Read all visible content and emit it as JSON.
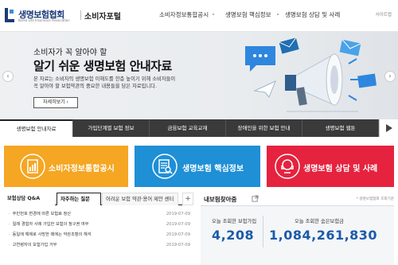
{
  "header": {
    "logo_text": "생명보험협회",
    "logo_sub": "Korea Life Insurance Association",
    "portal_title": "소비자포털",
    "nav": [
      "소비자정보통합공시",
      "생명보험 핵심정보",
      "생명보험 상담 및 사례"
    ],
    "site_map": "사이트맵"
  },
  "hero": {
    "subtitle": "소비자가 꼭 알아야 할",
    "title": "알기 쉬운 생명보험 안내자료",
    "desc_line1": "본 자료는 소비자의 생명보험 이해도를 한층 높이기 위해 소비자들이",
    "desc_line2": "꼭 알아야 할 보험약관의 중요한 내용들을 담은 자료입니다.",
    "button": "자세히보기 ›",
    "prev": "‹",
    "next": "›"
  },
  "tabs": [
    "생명보험 안내자료",
    "가입단계별 보험 정보",
    "금융보험 교육교재",
    "장애인을 위한 보험 안내",
    "생명보험 웹툰"
  ],
  "big_buttons": [
    {
      "label": "소비자정보통합공시",
      "color": "#f5a623",
      "icon": "document-chart-icon"
    },
    {
      "label": "생명보험 핵심정보",
      "color": "#1f8fd6",
      "icon": "document-search-icon"
    },
    {
      "label": "생명보험 상담 및 사례",
      "color": "#e5233f",
      "icon": "consultation-icon"
    }
  ],
  "qa": {
    "tabs": [
      "보험상담 Q&A",
      "자주하는 질문",
      "어려운 보험 약관·용어 제안 센터"
    ],
    "plus": "+",
    "rows": [
      {
        "title": "주민번호 변경에 따른 보험료 정산",
        "date": "2019-07-09"
      },
      {
        "title": "일례 경험자 사례 가입한 보험의 청구권 여부",
        "date": "2019-07-09"
      },
      {
        "title": "동일에 해제로 사망한 때에는 약관조항의 해석",
        "date": "2019-07-09"
      },
      {
        "title": "고연령자의 보험가입 거부",
        "date": "2019-07-09"
      }
    ]
  },
  "insurance_finder": {
    "title": "내보험찾아줌",
    "note": "* 생명보험협회 조회기준",
    "today_label": "오늘 조회한 보험가입",
    "today_value": "4,208",
    "hidden_label": "오늘 조회한 숨은보험금",
    "hidden_value": "1,084,261,830"
  }
}
